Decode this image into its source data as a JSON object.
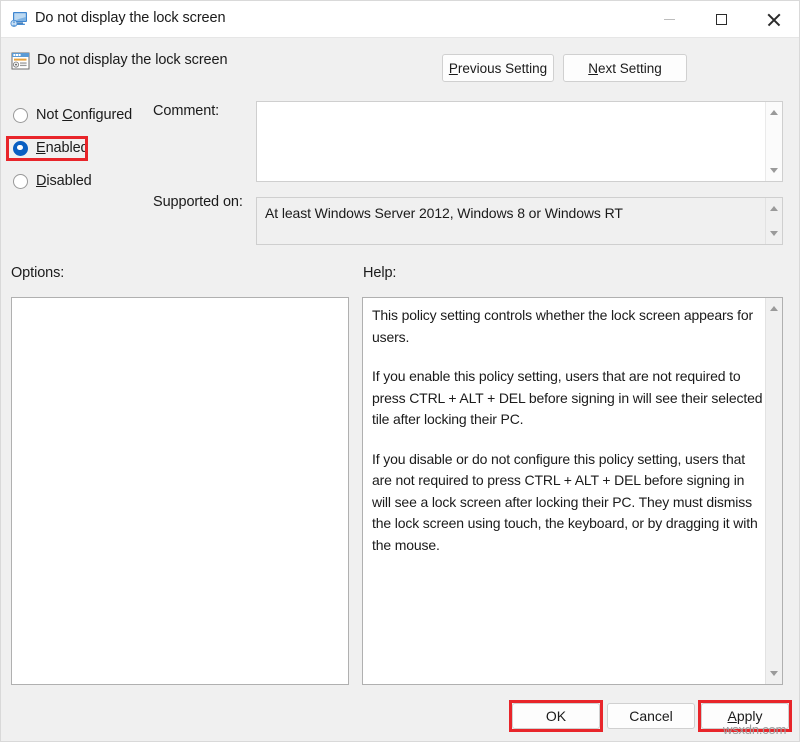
{
  "window": {
    "title": "Do not display the lock screen",
    "icon": "monitor-icon",
    "minimize_label": "Minimize",
    "maximize_label": "Maximize",
    "close_label": "Close"
  },
  "header": {
    "policy_icon": "policy-setting-icon",
    "policy_name": "Do not display the lock screen",
    "previous_setting": {
      "accel": "P",
      "rest": "revious Setting",
      "full": "Previous Setting"
    },
    "next_setting": {
      "accel": "N",
      "rest": "ext Setting",
      "full": "Next Setting"
    }
  },
  "state": {
    "selected": "Enabled",
    "options": [
      {
        "id": "not-configured",
        "pre": "Not ",
        "accel": "C",
        "rest": "onfigured",
        "full": "Not Configured",
        "checked": false
      },
      {
        "id": "enabled",
        "pre": "",
        "accel": "E",
        "rest": "nabled",
        "full": "Enabled",
        "checked": true
      },
      {
        "id": "disabled",
        "pre": "",
        "accel": "D",
        "rest": "isabled",
        "full": "Disabled",
        "checked": false
      }
    ]
  },
  "fields": {
    "comment_label": "Comment:",
    "comment_value": "",
    "supported_label": "Supported on:",
    "supported_value": "At least Windows Server 2012, Windows 8 or Windows RT",
    "options_label": "Options:",
    "options_value": "",
    "help_label": "Help:"
  },
  "help": {
    "paragraphs": [
      "This policy setting controls whether the lock screen appears for users.",
      "If you enable this policy setting, users that are not required to press CTRL + ALT + DEL before signing in will see their selected tile after locking their PC.",
      "If you disable or do not configure this policy setting, users that are not required to press CTRL + ALT + DEL before signing in will see a lock screen after locking their PC. They must dismiss the lock screen using touch, the keyboard, or by dragging it with the mouse."
    ]
  },
  "footer": {
    "ok": "OK",
    "cancel": "Cancel",
    "apply": {
      "accel": "A",
      "rest": "pply",
      "full": "Apply"
    }
  },
  "annotations": {
    "highlight_color": "#e8252a",
    "highlighted": [
      "Enabled",
      "OK",
      "Apply"
    ]
  },
  "watermark": "wsxdn.com"
}
